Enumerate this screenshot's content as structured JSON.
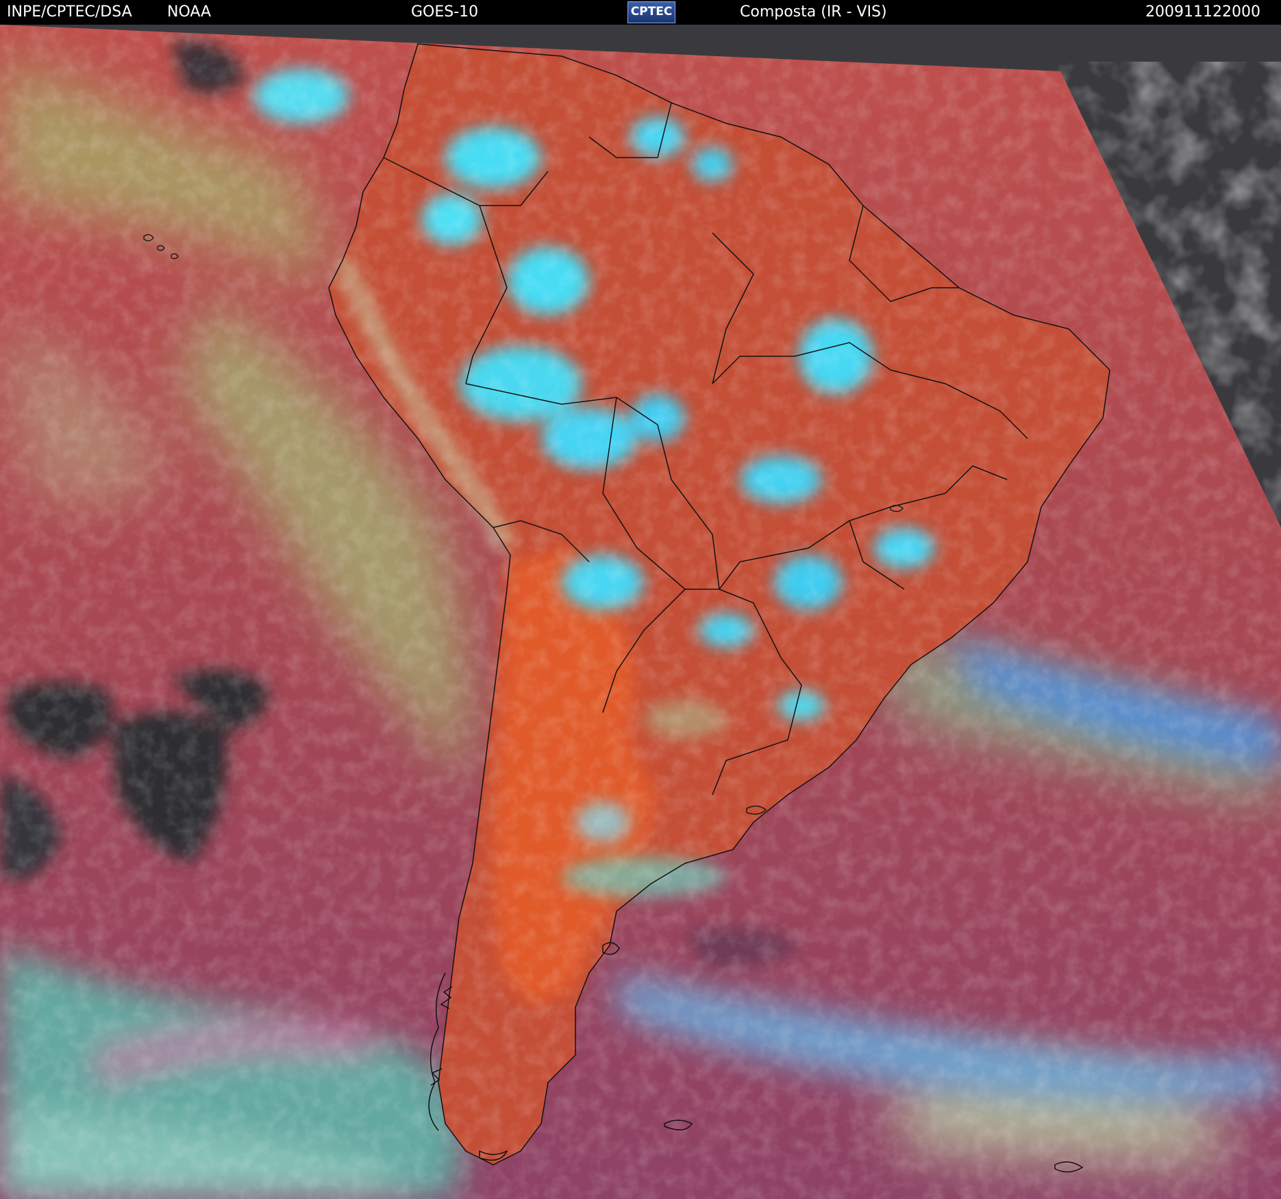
{
  "header": {
    "organization": "INPE/CPTEC/DSA",
    "agency": "NOAA",
    "satellite": "GOES-10",
    "logo_text": "CPTEC",
    "product": "Composta (IR - VIS)",
    "timestamp": "200911122000"
  },
  "colors": {
    "background": "#000000",
    "header_text": "#ffffff",
    "clear_land": "#c8503a",
    "cold_cloud": "#40d8f0",
    "low_cloud": "#a8b070",
    "ocean": "#a04858",
    "night_side": "#3c3c40",
    "cloud_gap": "#2c2c30",
    "borders": "#101010"
  }
}
